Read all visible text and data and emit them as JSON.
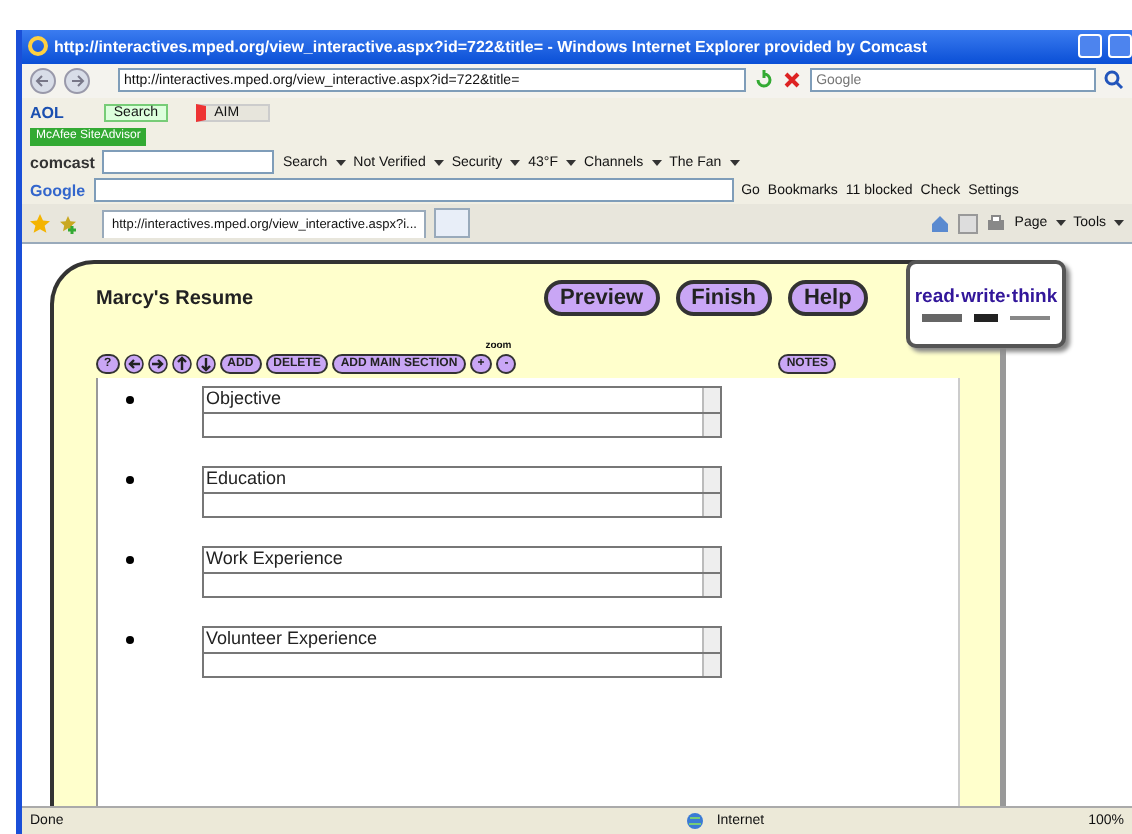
{
  "window": {
    "title": "http://interactives.mped.org/view_interactive.aspx?id=722&title= - Windows Internet Explorer provided by Comcast"
  },
  "address_bar": {
    "url": "http://interactives.mped.org/view_interactive.aspx?id=722&title="
  },
  "search_field": {
    "placeholder": "Google"
  },
  "aol_toolbar": {
    "brand": "AOL",
    "search_button": "Search",
    "aim_button": "AIM"
  },
  "mcafee_button": "McAfee SiteAdvisor",
  "comcast_toolbar": {
    "brand": "comcast",
    "items": [
      "Search",
      "Not Verified",
      "Security",
      "43°F",
      "Channels",
      "The Fan"
    ]
  },
  "google_toolbar": {
    "brand": "Google",
    "items": [
      "Go",
      "Bookmarks",
      "11 blocked",
      "Check",
      "Settings"
    ]
  },
  "tabs": [
    {
      "label": "http://interactives.mped.org/view_interactive.aspx?i...",
      "selected": true
    }
  ],
  "command_bar": [
    "Page",
    "Tools"
  ],
  "app": {
    "title": "Marcy's Resume",
    "nav_buttons": [
      "Preview",
      "Finish",
      "Help"
    ],
    "logo": "read·write·think",
    "toolbar": [
      {
        "kind": "text",
        "label": "?"
      },
      {
        "kind": "left"
      },
      {
        "kind": "right"
      },
      {
        "kind": "up"
      },
      {
        "kind": "down"
      },
      {
        "kind": "text",
        "label": "ADD"
      },
      {
        "kind": "text",
        "label": "DELETE"
      },
      {
        "kind": "text",
        "label": "ADD MAIN SECTION"
      }
    ],
    "zoom_label": "zoom",
    "zoom_buttons": [
      "+",
      "-"
    ],
    "notes_button": "NOTES",
    "sections": [
      "Objective",
      "Education",
      "Work Experience",
      "Volunteer Experience"
    ]
  },
  "status_bar": {
    "text": "Done",
    "zone": "Internet",
    "zoom": "100%"
  }
}
